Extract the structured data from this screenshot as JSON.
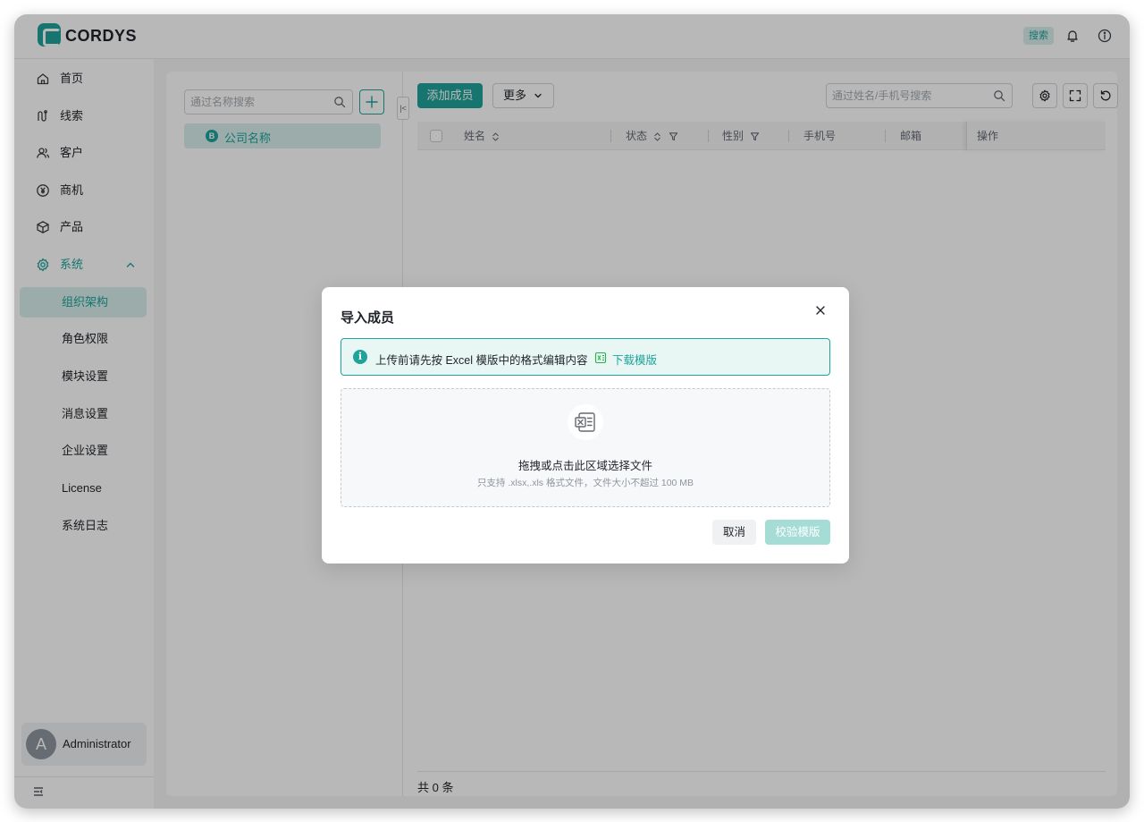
{
  "header": {
    "brand": "CORDYS",
    "search_label": "搜索"
  },
  "sidebar": {
    "items": [
      {
        "label": "首页",
        "icon": "home-icon"
      },
      {
        "label": "线索",
        "icon": "leads-icon"
      },
      {
        "label": "客户",
        "icon": "customers-icon"
      },
      {
        "label": "商机",
        "icon": "yen-icon"
      },
      {
        "label": "产品",
        "icon": "box-icon"
      },
      {
        "label": "系统",
        "icon": "gear-icon"
      }
    ],
    "sub_items": [
      "组织架构",
      "角色权限",
      "模块设置",
      "消息设置",
      "企业设置",
      "License",
      "系统日志"
    ],
    "user": {
      "avatar_letter": "A",
      "name": "Administrator"
    }
  },
  "org": {
    "search_placeholder": "通过名称搜索",
    "node_label": "公司名称"
  },
  "members": {
    "add_button": "添加成员",
    "more_button": "更多",
    "search_placeholder": "通过姓名/手机号搜索",
    "columns": [
      "姓名",
      "状态",
      "性别",
      "手机号",
      "邮箱",
      "操作"
    ],
    "total": "共 0 条"
  },
  "modal": {
    "title": "导入成员",
    "alert_text": "上传前请先按 Excel 模版中的格式编辑内容",
    "download_link": "下载模版",
    "drop_title": "拖拽或点击此区域选择文件",
    "drop_hint": "只支持 .xlsx,.xls 格式文件，文件大小不超过 100 MB",
    "cancel": "取消",
    "verify": "校验模版"
  },
  "colors": {
    "accent": "#1fa39a",
    "accent_light": "#d7efec"
  }
}
